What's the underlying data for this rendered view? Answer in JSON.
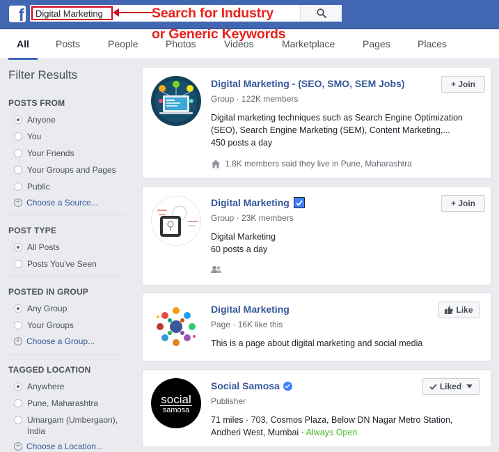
{
  "header": {
    "logo": "f",
    "search_value": "Digital Marketing",
    "annotation_line1": "Search for Industry",
    "annotation_line2": "or Generic Keywords",
    "search_icon": "search-icon"
  },
  "tabs": [
    {
      "label": "All",
      "active": true
    },
    {
      "label": "Posts"
    },
    {
      "label": "People"
    },
    {
      "label": "Photos"
    },
    {
      "label": "Videos"
    },
    {
      "label": "Marketplace"
    },
    {
      "label": "Pages"
    },
    {
      "label": "Places"
    }
  ],
  "sidebar": {
    "title": "Filter Results",
    "posts_from": {
      "heading": "POSTS FROM",
      "options": [
        "Anyone",
        "You",
        "Your Friends",
        "Your Groups and Pages",
        "Public"
      ],
      "selected": 0,
      "choose": "Choose a Source..."
    },
    "post_type": {
      "heading": "POST TYPE",
      "options": [
        "All Posts",
        "Posts You've Seen"
      ],
      "selected": 0
    },
    "posted_in_group": {
      "heading": "POSTED IN GROUP",
      "options": [
        "Any Group",
        "Your Groups"
      ],
      "selected": 0,
      "choose": "Choose a Group..."
    },
    "tagged_location": {
      "heading": "TAGGED LOCATION",
      "options": [
        "Anywhere",
        "Pune, Maharashtra",
        "Umargam (Umbergaon), India"
      ],
      "selected": 0,
      "choose": "Choose a Location..."
    }
  },
  "results": [
    {
      "name": "Digital Marketing - (SEO, SMO, SEM Jobs)",
      "meta": "Group · 122K members",
      "desc_line1": "Digital marketing techniques such as Search Engine Optimization",
      "desc_line2": "(SEO), Search Engine Marketing (SEM), Content Marketing,...",
      "desc_line3": "450 posts a day",
      "footer": "1.8K members said they live in Pune, Maharashtra",
      "button": "+ Join"
    },
    {
      "name": "Digital Marketing",
      "meta": "Group · 23K members",
      "desc_line1": "Digital Marketing",
      "desc_line2": "60 posts a day",
      "button": "+ Join"
    },
    {
      "name": "Digital Marketing",
      "meta": "Page · 16K like this",
      "desc_line1": "This is a page about digital marketing and social media",
      "button": "Like"
    },
    {
      "name": "Social Samosa",
      "meta": "Publisher",
      "avatar_text_1": "social",
      "avatar_text_2": "samosa",
      "desc_line1": "71 miles · 703, Cosmos Plaza, Below DN Nagar Metro Station,",
      "desc_line2": "Andheri West, Mumbai · ",
      "open_status": "Always Open",
      "button": "Liked"
    }
  ],
  "colors": {
    "header_blue": "#4267b2",
    "link_blue": "#365899",
    "annotation_red": "#e8211b",
    "open_green": "#42b72a"
  }
}
